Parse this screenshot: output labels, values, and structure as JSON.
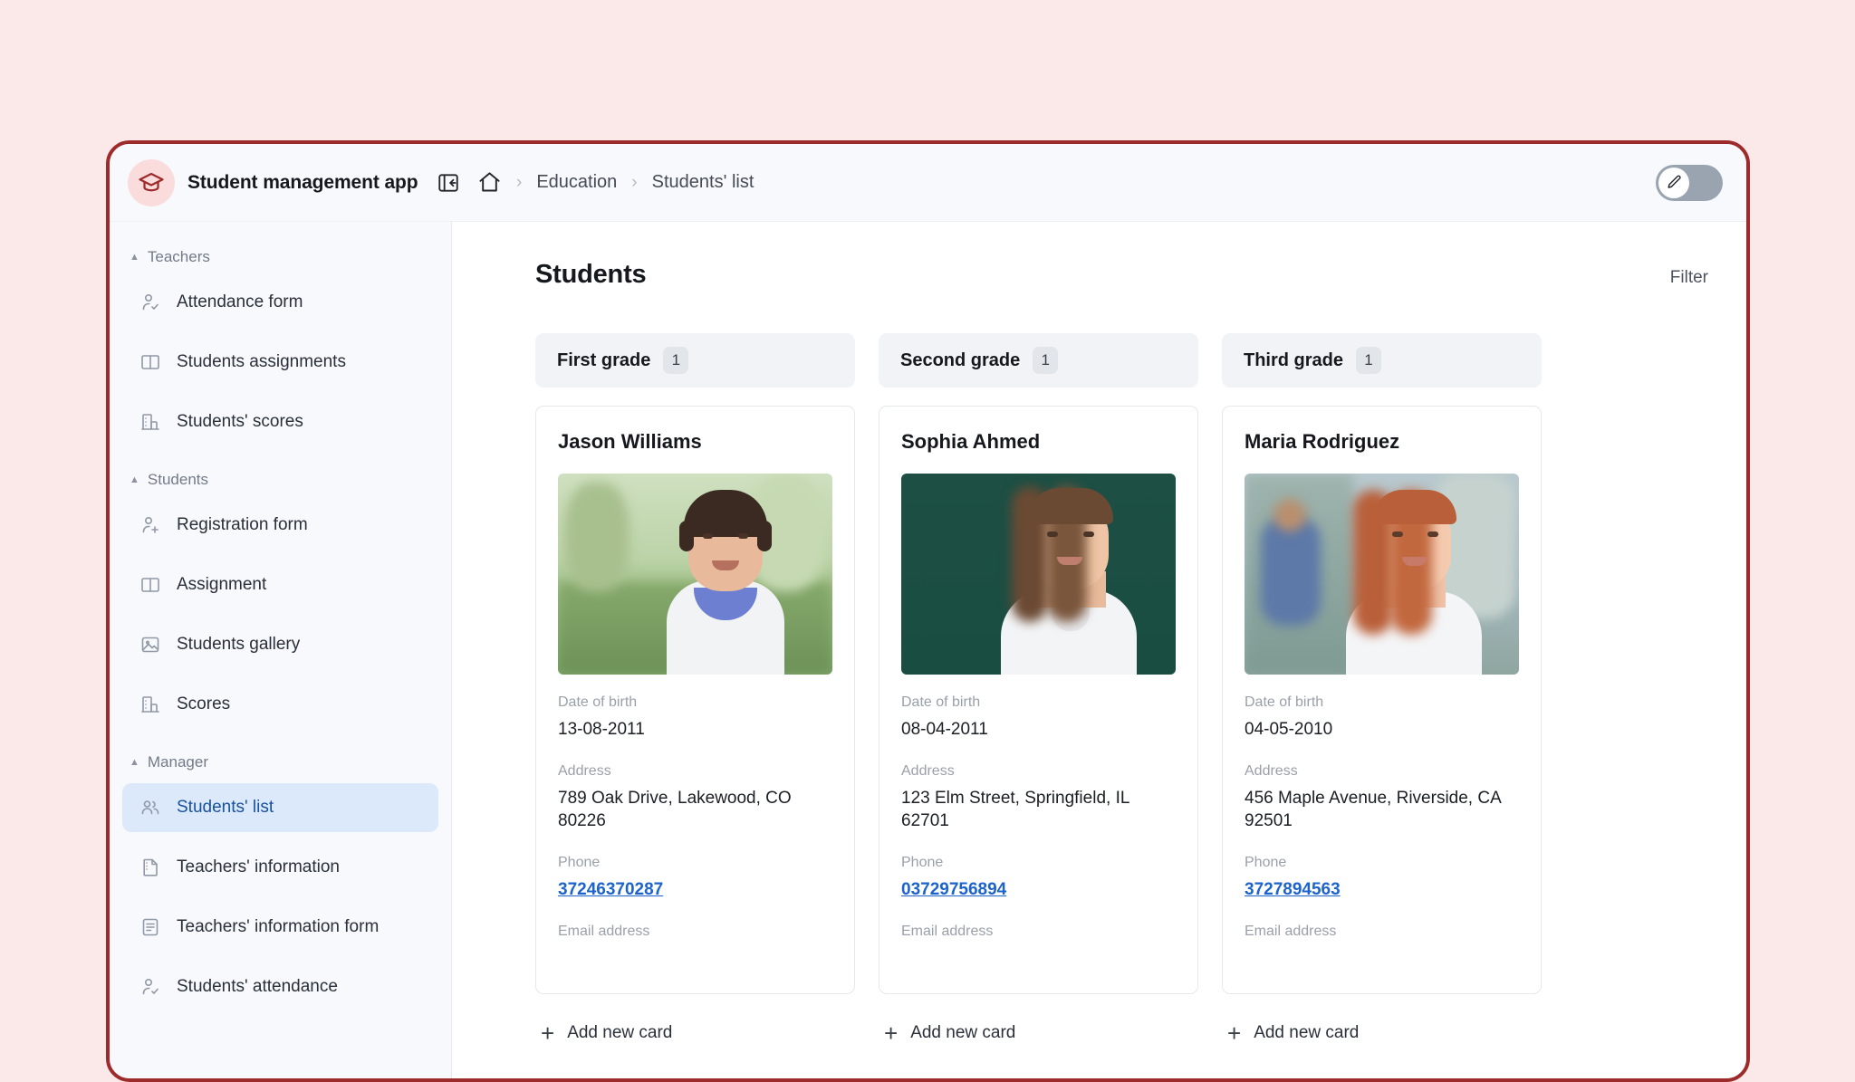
{
  "app": {
    "brand_title": "Student management app",
    "logo_icon": "graduation-cap-icon",
    "collapse_icon": "panel-collapse-icon",
    "edit_toggle_icon": "pencil-icon"
  },
  "breadcrumb": {
    "home_icon": "home-icon",
    "separator": "›",
    "items": [
      {
        "label": "Education"
      },
      {
        "label": "Students' list"
      }
    ]
  },
  "sidebar": {
    "groups": [
      {
        "title": "Teachers",
        "caret": "▲",
        "items": [
          {
            "label": "Attendance form",
            "icon": "user-check-icon"
          },
          {
            "label": "Students assignments",
            "icon": "book-open-icon"
          },
          {
            "label": "Students' scores",
            "icon": "building-chart-icon"
          }
        ]
      },
      {
        "title": "Students",
        "caret": "▲",
        "items": [
          {
            "label": "Registration form",
            "icon": "user-plus-icon"
          },
          {
            "label": "Assignment",
            "icon": "book-open-icon"
          },
          {
            "label": "Students gallery",
            "icon": "image-icon"
          },
          {
            "label": "Scores",
            "icon": "building-chart-icon"
          }
        ]
      },
      {
        "title": "Manager",
        "caret": "▲",
        "items": [
          {
            "label": "Students' list",
            "icon": "users-icon",
            "active": true
          },
          {
            "label": "Teachers' information",
            "icon": "file-icon"
          },
          {
            "label": "Teachers' information form",
            "icon": "document-lines-icon"
          },
          {
            "label": "Students' attendance",
            "icon": "user-check-icon"
          }
        ]
      }
    ]
  },
  "main": {
    "page_title": "Students",
    "filter_label": "Filter",
    "add_card_label": "Add new card",
    "add_card_icon": "plus-icon",
    "field_labels": {
      "dob": "Date of birth",
      "address": "Address",
      "phone": "Phone",
      "email": "Email address"
    },
    "columns": [
      {
        "title": "First grade",
        "count": "1",
        "card": {
          "name": "Jason Williams",
          "photo": "photo-boy-outdoors",
          "dob": "13-08-2011",
          "address": "789 Oak Drive, Lakewood, CO 80226",
          "phone": "37246370287"
        }
      },
      {
        "title": "Second grade",
        "count": "1",
        "card": {
          "name": "Sophia Ahmed",
          "photo": "photo-girl-chalkboard",
          "dob": "08-04-2011",
          "address": "123 Elm Street, Springfield, IL 62701",
          "phone": "03729756894"
        }
      },
      {
        "title": "Third grade",
        "count": "1",
        "card": {
          "name": "Maria Rodriguez",
          "photo": "photo-girl-campus",
          "dob": "04-05-2010",
          "address": "456 Maple Avenue, Riverside, CA 92501",
          "phone": "3727894563"
        }
      }
    ]
  },
  "colors": {
    "page_background": "#fbe9e9",
    "frame_border": "#9e2b2b",
    "accent_link": "#1d63cc",
    "active_nav_bg": "#dbe9fb",
    "active_nav_text": "#18519e"
  }
}
